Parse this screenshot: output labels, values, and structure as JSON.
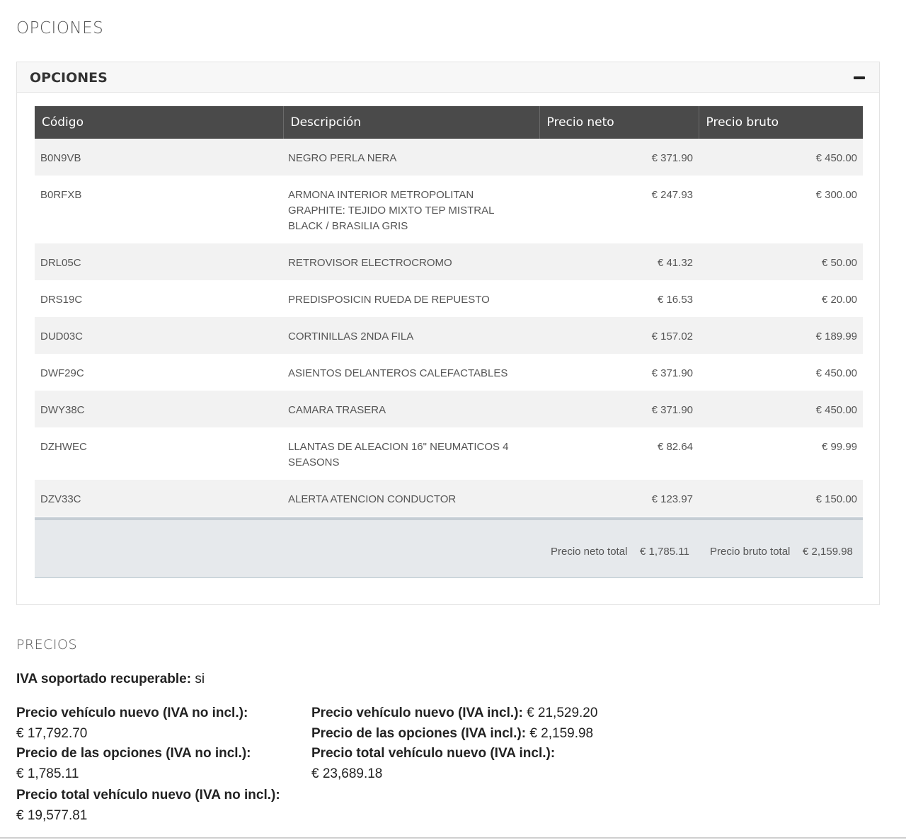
{
  "section_opciones": "OPCIONES",
  "panel": {
    "title": "OPCIONES",
    "collapse_icon": "minus-icon"
  },
  "table": {
    "headers": [
      "Código",
      "Descripción",
      "Precio neto",
      "Precio bruto"
    ],
    "rows": [
      {
        "code": "B0N9VB",
        "desc": "NEGRO PERLA NERA",
        "neto": "€ 371.90",
        "bruto": "€ 450.00"
      },
      {
        "code": "B0RFXB",
        "desc": "ARMONA INTERIOR METROPOLITAN GRAPHITE: TEJIDO MIXTO TEP MISTRAL BLACK / BRASILIA GRIS",
        "neto": "€ 247.93",
        "bruto": "€ 300.00"
      },
      {
        "code": "DRL05C",
        "desc": "RETROVISOR ELECTROCROMO",
        "neto": "€ 41.32",
        "bruto": "€ 50.00"
      },
      {
        "code": "DRS19C",
        "desc": "PREDISPOSICIN RUEDA DE REPUESTO",
        "neto": "€ 16.53",
        "bruto": "€ 20.00"
      },
      {
        "code": "DUD03C",
        "desc": "CORTINILLAS 2NDA FILA",
        "neto": "€ 157.02",
        "bruto": "€ 189.99"
      },
      {
        "code": "DWF29C",
        "desc": "ASIENTOS DELANTEROS CALEFACTABLES",
        "neto": "€ 371.90",
        "bruto": "€ 450.00"
      },
      {
        "code": "DWY38C",
        "desc": "CAMARA TRASERA",
        "neto": "€ 371.90",
        "bruto": "€ 450.00"
      },
      {
        "code": "DZHWEC",
        "desc": "LLANTAS DE ALEACION 16\" NEUMATICOS 4 SEASONS",
        "neto": "€ 82.64",
        "bruto": "€ 99.99"
      },
      {
        "code": "DZV33C",
        "desc": "ALERTA ATENCION CONDUCTOR",
        "neto": "€ 123.97",
        "bruto": "€ 150.00"
      }
    ]
  },
  "totals": {
    "neto_label": "Precio neto total",
    "neto_value": "€ 1,785.11",
    "bruto_label": "Precio bruto total",
    "bruto_value": "€ 2,159.98"
  },
  "section_precios": "PRECIOS",
  "precios": {
    "iva_label": "IVA soportado recuperable:",
    "iva_value": "si",
    "left": [
      {
        "label": "Precio vehículo nuevo (IVA no incl.):",
        "value": "€ 17,792.70"
      },
      {
        "label": "Precio de las opciones (IVA no incl.):",
        "value": "€ 1,785.11"
      },
      {
        "label": "Precio total vehículo nuevo (IVA no incl.):",
        "value": "€ 19,577.81"
      }
    ],
    "right": [
      {
        "label": "Precio vehículo nuevo (IVA incl.):",
        "value": "€ 21,529.20"
      },
      {
        "label": "Precio de las opciones (IVA incl.):",
        "value": "€ 2,159.98"
      },
      {
        "label": "Precio total vehículo nuevo (IVA incl.):",
        "value": "€ 23,689.18"
      }
    ]
  }
}
